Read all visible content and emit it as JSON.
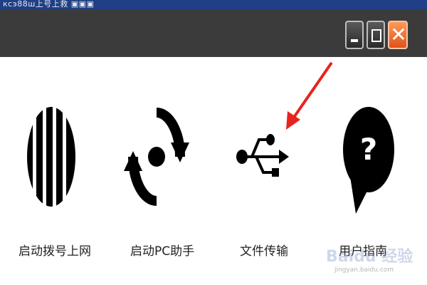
{
  "window": {
    "top_strip_text": "ксэ88ш上号上救 ▣▣▣",
    "controls": {
      "minimize_label": "minimize",
      "maximize_label": "maximize",
      "close_label": "close"
    }
  },
  "actions": [
    {
      "label": "启动拨号上网",
      "icon": "globe-stripes-icon"
    },
    {
      "label": "启动PC助手",
      "icon": "sync-cycle-icon"
    },
    {
      "label": "文件传输",
      "icon": "usb-icon"
    },
    {
      "label": "用户指南",
      "icon": "help-speech-bubble-icon"
    }
  ],
  "annotation": {
    "arrow_color": "#e8231e"
  },
  "watermark": {
    "brand": "Baidu 经验",
    "url": "jingyan.baidu.com"
  },
  "colors": {
    "titlebar": "#3b3b3b",
    "top_strip": "#1f3f86",
    "close_button": "#f06a2e",
    "icon": "#000000"
  }
}
